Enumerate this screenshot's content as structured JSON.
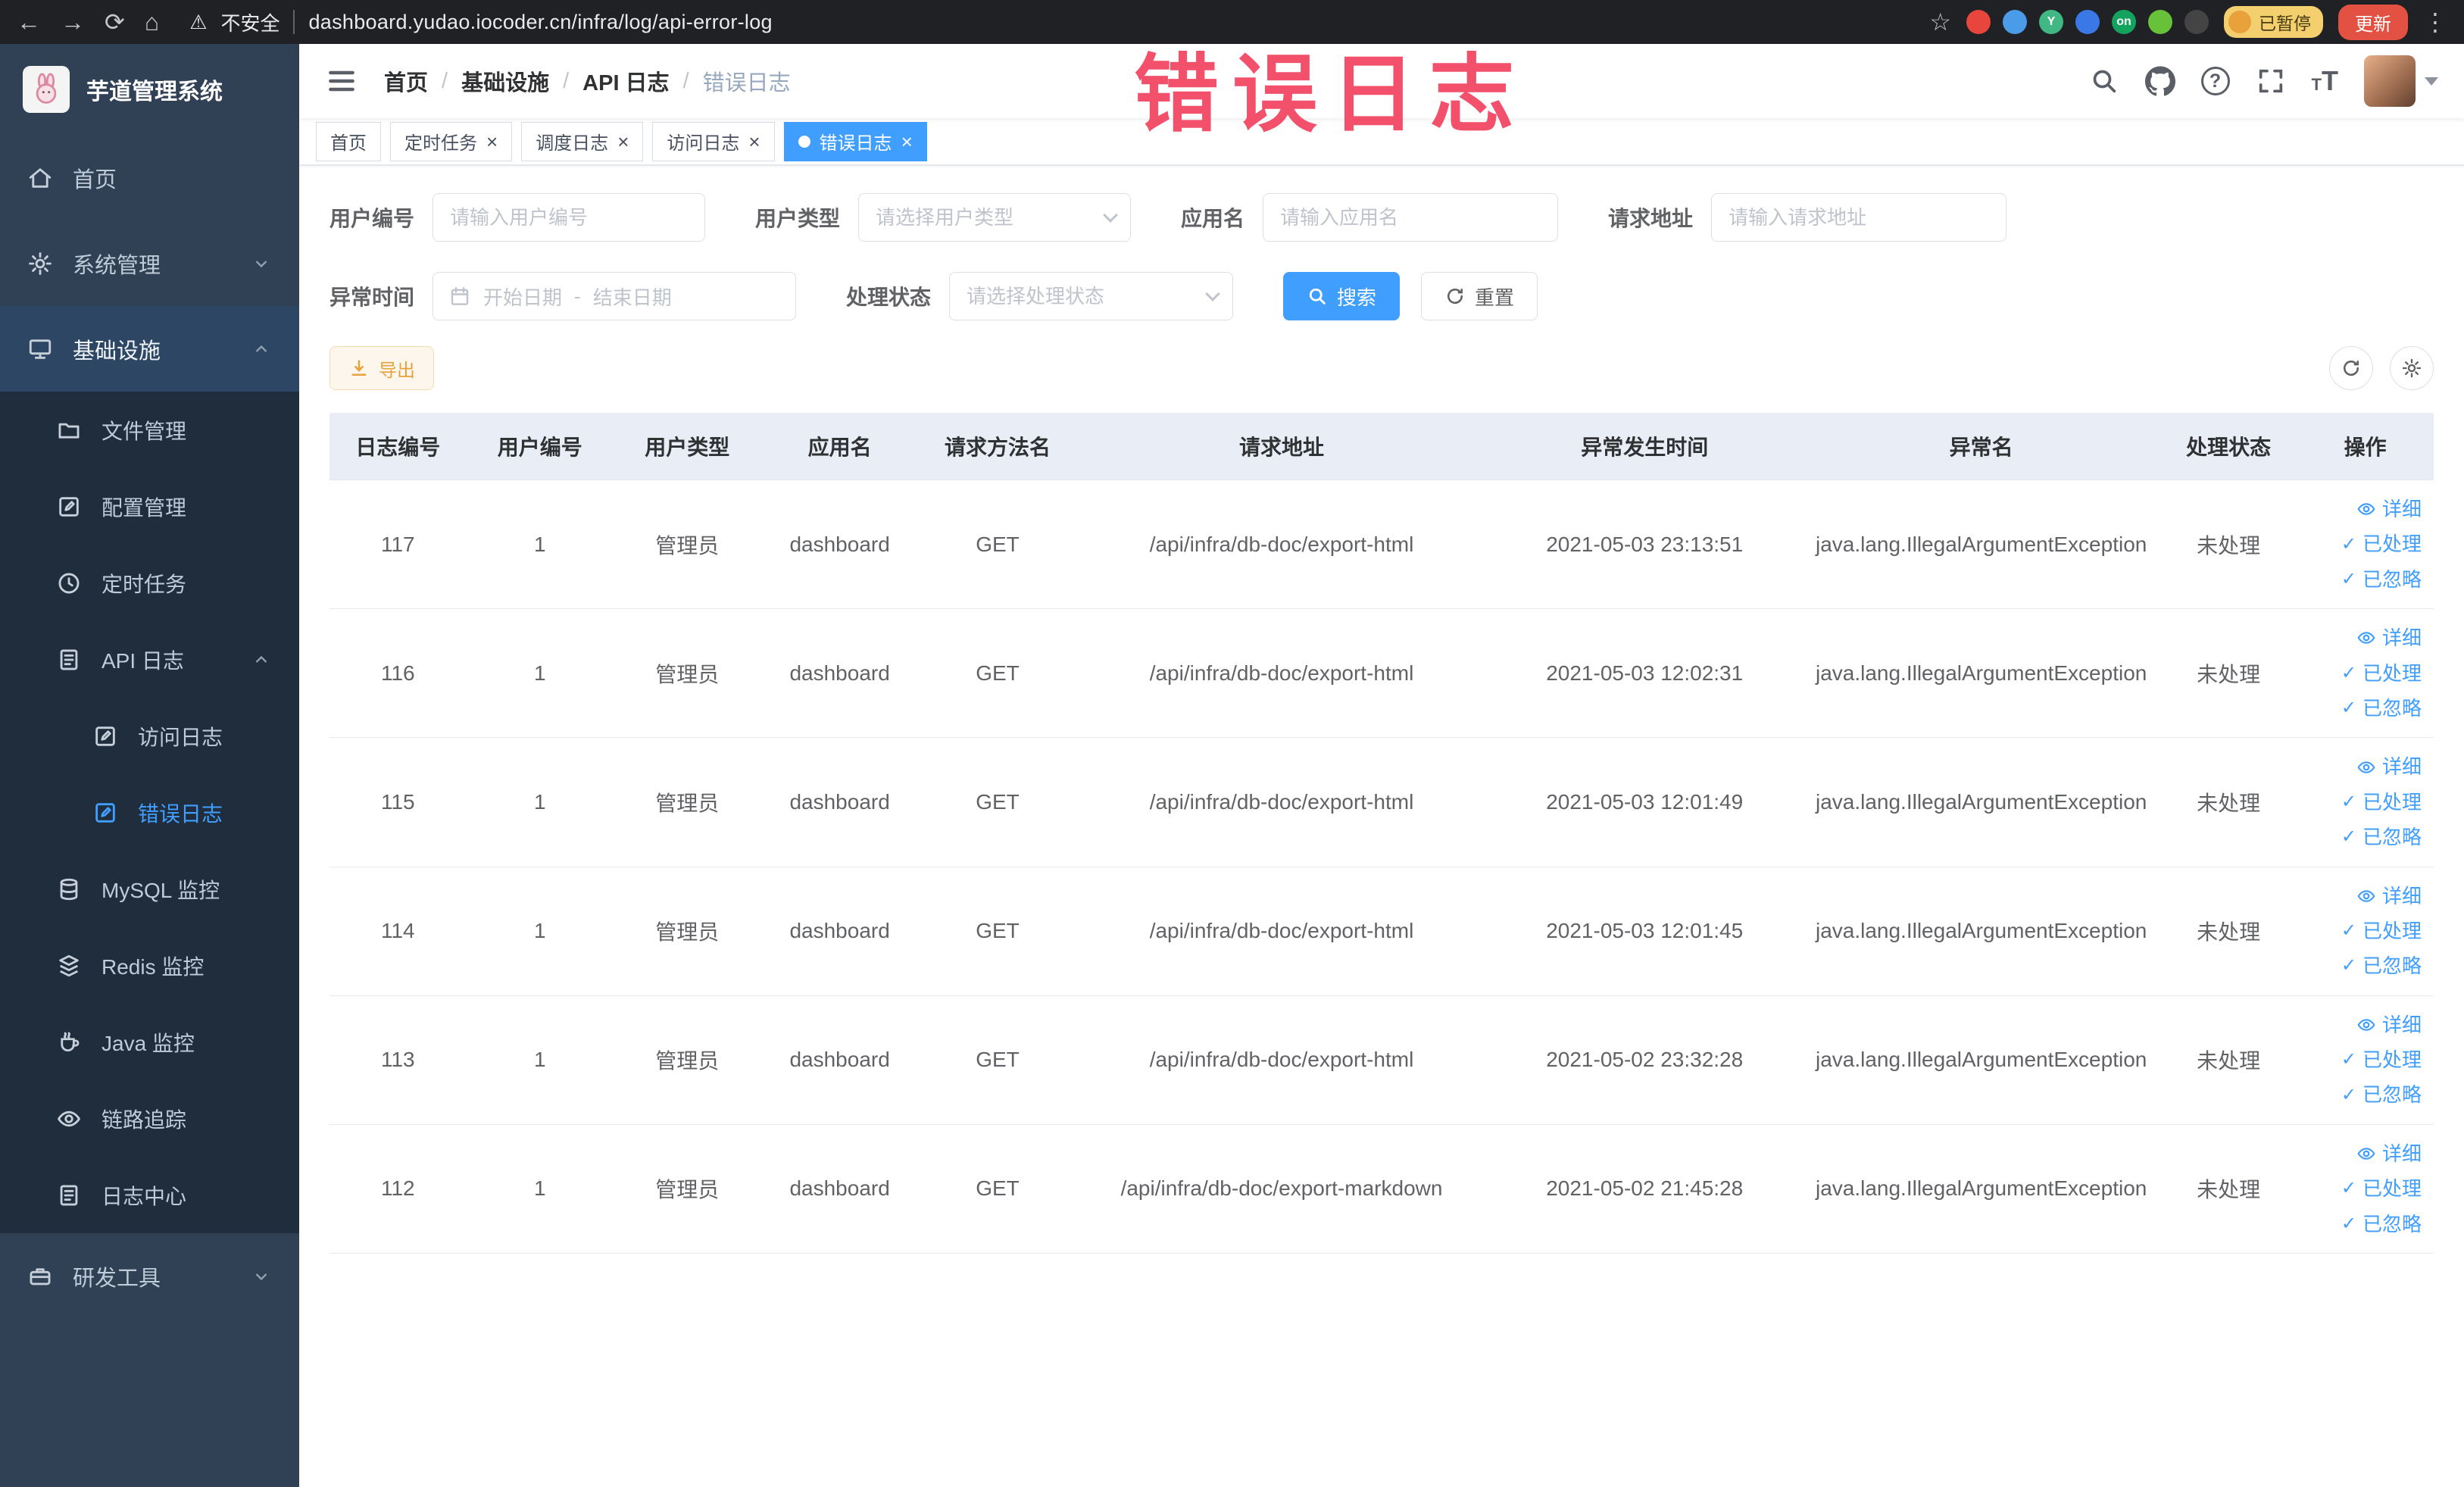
{
  "colors": {
    "accent": "#409EFF",
    "sidebar_bg": "#304156",
    "submenu_bg": "#1f2d3d",
    "annotation": "#f13858",
    "warning": "#e6a23c",
    "active_tab_bg": "#409EFF",
    "table_header_bg": "#e9eef6"
  },
  "icons": {
    "back": "←",
    "forward": "→",
    "reload": "⟳",
    "home": "⌂",
    "warning": "⚠",
    "star": "☆",
    "kebab": "⋮",
    "close": "×",
    "check": "✓",
    "question": "?",
    "font_size": "T"
  },
  "browser": {
    "security_label": "不安全",
    "url": "dashboard.yudao.iocoder.cn/infra/log/api-error-log",
    "extensions": [
      {
        "bg": "#e8453c",
        "label": ""
      },
      {
        "bg": "#4a9be8",
        "label": ""
      },
      {
        "bg": "#41b883",
        "label": "Y"
      },
      {
        "bg": "#3b78e7",
        "label": ""
      },
      {
        "bg": "#13a35e",
        "label": "on"
      },
      {
        "bg": "#67c23a",
        "label": ""
      },
      {
        "bg": "#444444",
        "label": ""
      }
    ],
    "paused_label": "已暂停",
    "update_label": "更新"
  },
  "sidebar": {
    "title": "芋道管理系统",
    "items": {
      "home": "首页",
      "system": "系统管理",
      "infra": "基础设施",
      "file": "文件管理",
      "config": "配置管理",
      "job": "定时任务",
      "api_log": "API 日志",
      "access_log": "访问日志",
      "error_log": "错误日志",
      "mysql": "MySQL 监控",
      "redis": "Redis 监控",
      "java": "Java 监控",
      "trace": "链路追踪",
      "log_center": "日志中心",
      "devtools": "研发工具"
    }
  },
  "header": {
    "separator": "/",
    "breadcrumb": [
      "首页",
      "基础设施",
      "API 日志",
      "错误日志"
    ]
  },
  "tabs": [
    {
      "label": "首页"
    },
    {
      "label": "定时任务"
    },
    {
      "label": "调度日志"
    },
    {
      "label": "访问日志"
    },
    {
      "label": "错误日志"
    }
  ],
  "filters": {
    "user_id_label": "用户编号",
    "user_id_placeholder": "请输入用户编号",
    "user_type_label": "用户类型",
    "user_type_placeholder": "请选择用户类型",
    "app_name_label": "应用名",
    "app_name_placeholder": "请输入应用名",
    "request_url_label": "请求地址",
    "request_url_placeholder": "请输入请求地址",
    "exception_time_label": "异常时间",
    "start_date_placeholder": "开始日期",
    "range_separator": "-",
    "end_date_placeholder": "结束日期",
    "process_status_label": "处理状态",
    "process_status_placeholder": "请选择处理状态",
    "search_label": "搜索",
    "reset_label": "重置"
  },
  "toolbar": {
    "export_label": "导出"
  },
  "table": {
    "headers": [
      "日志编号",
      "用户编号",
      "用户类型",
      "应用名",
      "请求方法名",
      "请求地址",
      "异常发生时间",
      "异常名",
      "处理状态",
      "操作"
    ],
    "actions": {
      "detail": "详细",
      "processed": "已处理",
      "ignored": "已忽略"
    },
    "rows": [
      {
        "id": "117",
        "user_id": "1",
        "user_type": "管理员",
        "app": "dashboard",
        "method": "GET",
        "url": "/api/infra/db-doc/export-html",
        "time": "2021-05-03 23:13:51",
        "exception": "java.lang.IllegalArgumentException",
        "status": "未处理"
      },
      {
        "id": "116",
        "user_id": "1",
        "user_type": "管理员",
        "app": "dashboard",
        "method": "GET",
        "url": "/api/infra/db-doc/export-html",
        "time": "2021-05-03 12:02:31",
        "exception": "java.lang.IllegalArgumentException",
        "status": "未处理"
      },
      {
        "id": "115",
        "user_id": "1",
        "user_type": "管理员",
        "app": "dashboard",
        "method": "GET",
        "url": "/api/infra/db-doc/export-html",
        "time": "2021-05-03 12:01:49",
        "exception": "java.lang.IllegalArgumentException",
        "status": "未处理"
      },
      {
        "id": "114",
        "user_id": "1",
        "user_type": "管理员",
        "app": "dashboard",
        "method": "GET",
        "url": "/api/infra/db-doc/export-html",
        "time": "2021-05-03 12:01:45",
        "exception": "java.lang.IllegalArgumentException",
        "status": "未处理"
      },
      {
        "id": "113",
        "user_id": "1",
        "user_type": "管理员",
        "app": "dashboard",
        "method": "GET",
        "url": "/api/infra/db-doc/export-html",
        "time": "2021-05-02 23:32:28",
        "exception": "java.lang.IllegalArgumentException",
        "status": "未处理"
      },
      {
        "id": "112",
        "user_id": "1",
        "user_type": "管理员",
        "app": "dashboard",
        "method": "GET",
        "url": "/api/infra/db-doc/export-markdown",
        "time": "2021-05-02 21:45:28",
        "exception": "java.lang.IllegalArgumentException",
        "status": "未处理"
      }
    ]
  },
  "overlay": {
    "text": "错误日志"
  }
}
